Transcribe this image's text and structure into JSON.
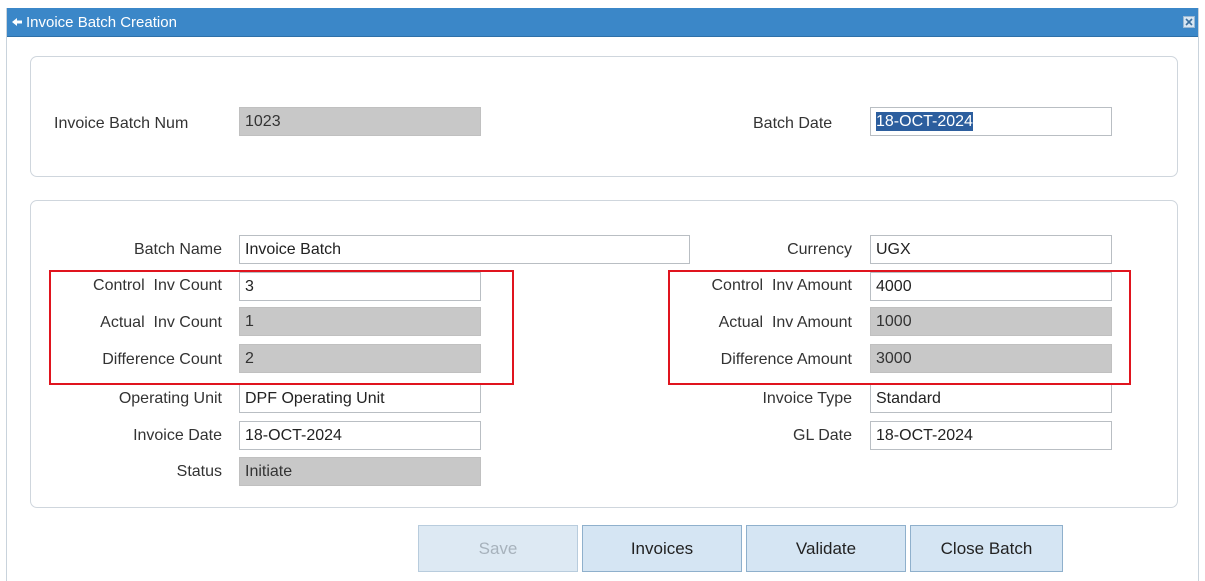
{
  "window": {
    "title": "Invoice Batch Creation",
    "close_icon": "close-x-icon",
    "title_icon": "form-icon"
  },
  "header_panel": {
    "batch_num_label": "Invoice Batch Num",
    "batch_num_value": "1023",
    "batch_date_label": "Batch Date",
    "batch_date_value": "18-OCT-2024"
  },
  "main_panel": {
    "batch_name_label": "Batch Name",
    "batch_name_value": "Invoice Batch",
    "currency_label": "Currency",
    "currency_value": "UGX",
    "control_inv_count_label": "Control  Inv Count",
    "control_inv_count_value": "3",
    "control_inv_amount_label": "Control  Inv Amount",
    "control_inv_amount_value": "4000",
    "actual_inv_count_label": "Actual  Inv Count",
    "actual_inv_count_value": "1",
    "actual_inv_amount_label": "Actual  Inv Amount",
    "actual_inv_amount_value": "1000",
    "difference_count_label": "Difference Count",
    "difference_count_value": "2",
    "difference_amount_label": "Difference Amount",
    "difference_amount_value": "3000",
    "operating_unit_label": "Operating Unit",
    "operating_unit_value": "DPF Operating Unit",
    "invoice_type_label": "Invoice Type",
    "invoice_type_value": "Standard",
    "invoice_date_label": "Invoice Date",
    "invoice_date_value": "18-OCT-2024",
    "gl_date_label": "GL Date",
    "gl_date_value": "18-OCT-2024",
    "status_label": "Status",
    "status_value": "Initiate"
  },
  "buttons": {
    "save": "Save",
    "invoices": "Invoices",
    "validate": "Validate",
    "close_batch": "Close Batch"
  },
  "colors": {
    "titlebar": "#3b87c8",
    "highlight_box": "#e0141e",
    "readonly_field": "#c8c8c8",
    "button_bg": "#d5e5f3"
  }
}
